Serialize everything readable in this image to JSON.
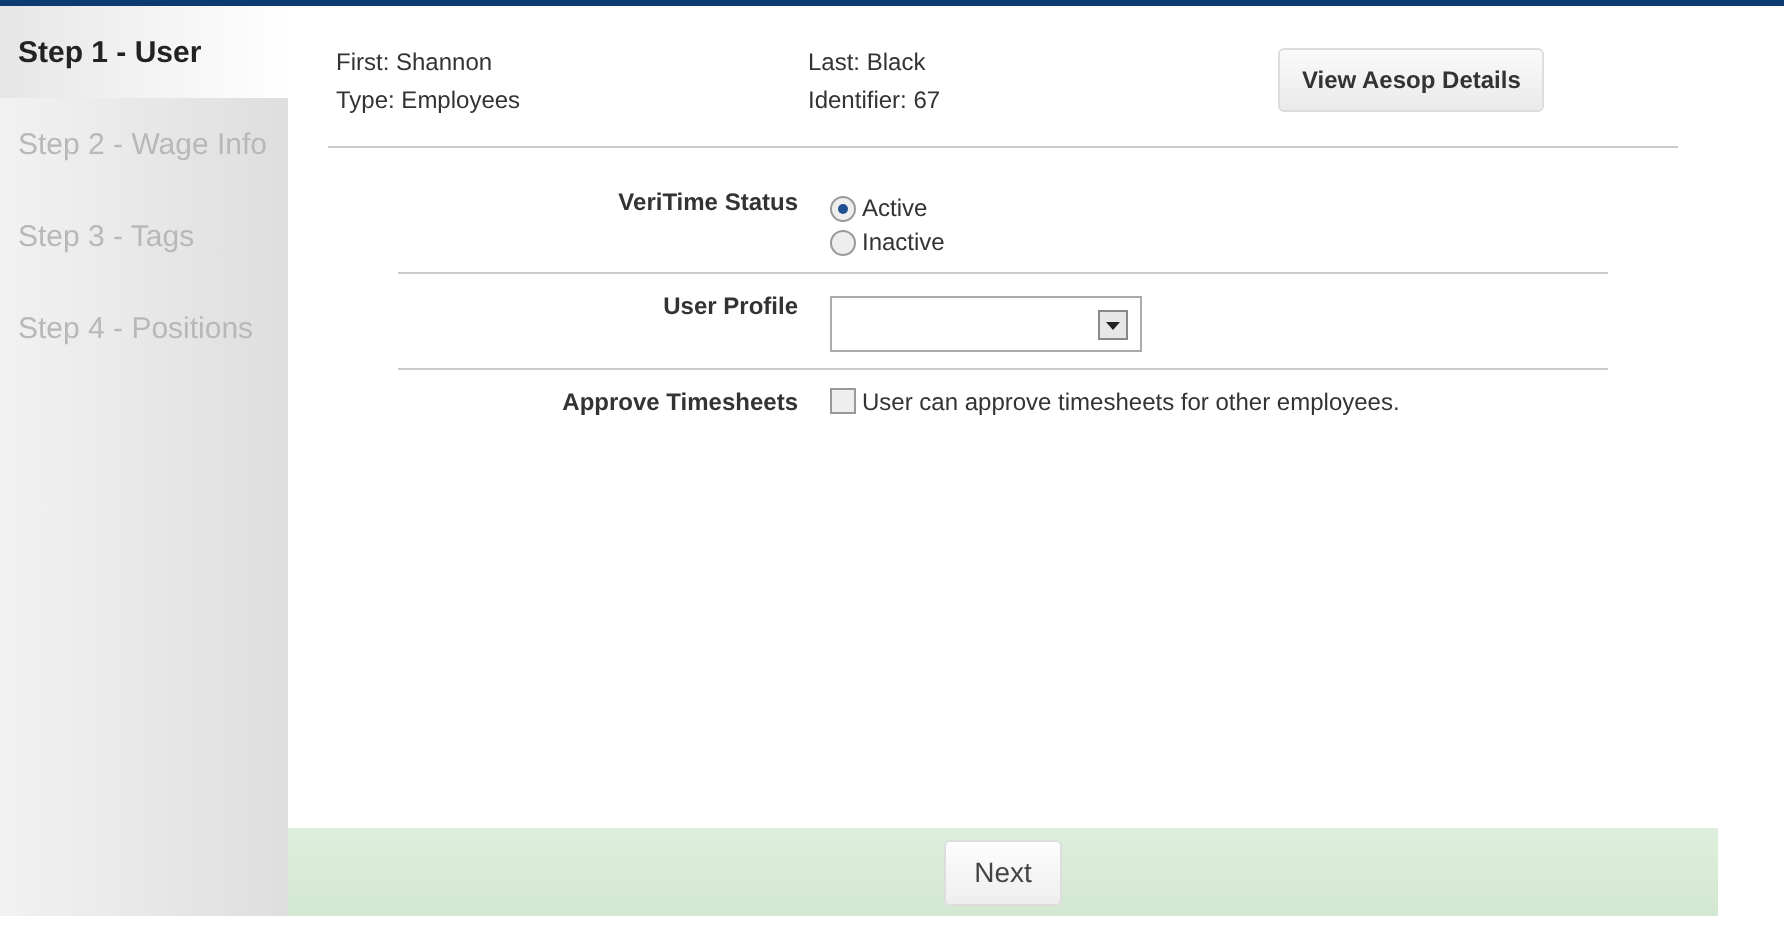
{
  "steps": [
    {
      "label": "Step 1 - User",
      "selected": true
    },
    {
      "label": "Step 2 - Wage Info",
      "selected": false
    },
    {
      "label": "Step 3 - Tags",
      "selected": false
    },
    {
      "label": "Step 4 - Positions",
      "selected": false
    }
  ],
  "user": {
    "first": "First: Shannon",
    "type": "Type: Employees",
    "last": "Last: Black",
    "identifier": "Identifier: 67",
    "details_button": "View Aesop Details"
  },
  "veritime_status": {
    "label": "VeriTime Status",
    "options": [
      {
        "label": "Active",
        "selected": true
      },
      {
        "label": "Inactive",
        "selected": false
      }
    ]
  },
  "user_profile": {
    "label": "User Profile"
  },
  "approve_timesheets": {
    "label": "Approve Timesheets",
    "checkbox_label": "User can approve timesheets for other employees.",
    "checked": false
  },
  "footer": {
    "next_button": "Next"
  }
}
